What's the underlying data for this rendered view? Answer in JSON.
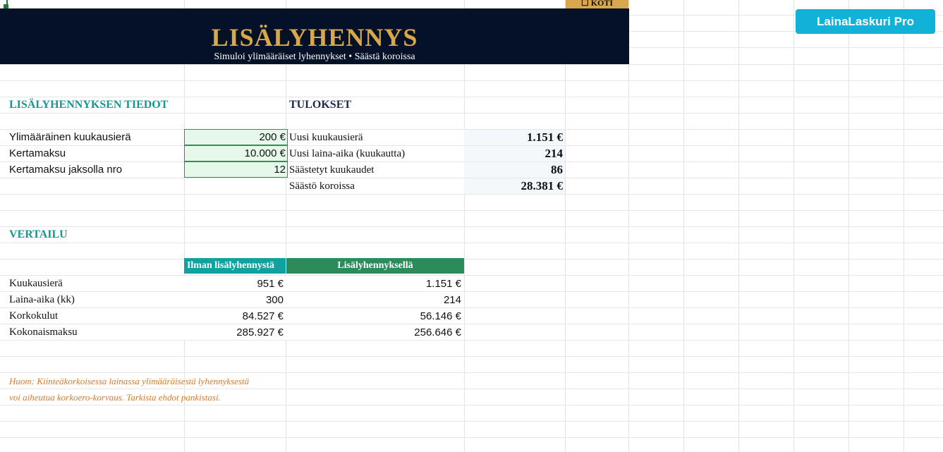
{
  "header": {
    "title": "LISÄLYHENNYS",
    "subtitle": "Simuloi ylimääräiset lyhennykset • Säästä koroissa",
    "home_button": "KOTI",
    "home_icon": "checkbox-icon"
  },
  "brand": {
    "label": "LainaLaskuri Pro"
  },
  "details": {
    "heading": "LISÄLYHENNYKSEN TIEDOT",
    "rows": [
      {
        "label": "Ylimääräinen kuukausierä",
        "value": "200 €"
      },
      {
        "label": "Kertamaksu",
        "value": "10.000 €"
      },
      {
        "label": "Kertamaksu jaksolla nro",
        "value": "12"
      }
    ]
  },
  "results": {
    "heading": "TULOKSET",
    "rows": [
      {
        "label": "Uusi kuukausierä",
        "value": "1.151 €"
      },
      {
        "label": "Uusi laina-aika (kuukautta)",
        "value": "214"
      },
      {
        "label": "Säästetyt kuukaudet",
        "value": "86"
      },
      {
        "label": "Säästö koroissa",
        "value": "28.381 €"
      }
    ]
  },
  "comparison": {
    "heading": "VERTAILU",
    "col1": "Ilman lisälyhennystä",
    "col2": "Lisälyhennyksellä",
    "rows": [
      {
        "label": "Kuukausierä",
        "v1": "951 €",
        "v2": "1.151 €"
      },
      {
        "label": "Laina-aika (kk)",
        "v1": "300",
        "v2": "214"
      },
      {
        "label": "Korkokulut",
        "v1": "84.527 €",
        "v2": "56.146 €"
      },
      {
        "label": "Kokonaismaksu",
        "v1": "285.927 €",
        "v2": "256.646 €"
      }
    ]
  },
  "note": {
    "line1": "Huom: Kiinteäkorkoisessa lainassa ylimääräisestä lyhennyksestä",
    "line2": "voi aiheutua korkoero-korvaus. Tarkista ehdot pankistasi."
  },
  "colors": {
    "banner": "#051126",
    "title_gold": "#d8a84a",
    "teal": "#16978f",
    "green": "#2c8b5b",
    "brand_cyan": "#12b2d8",
    "note_orange": "#d87a2a"
  }
}
